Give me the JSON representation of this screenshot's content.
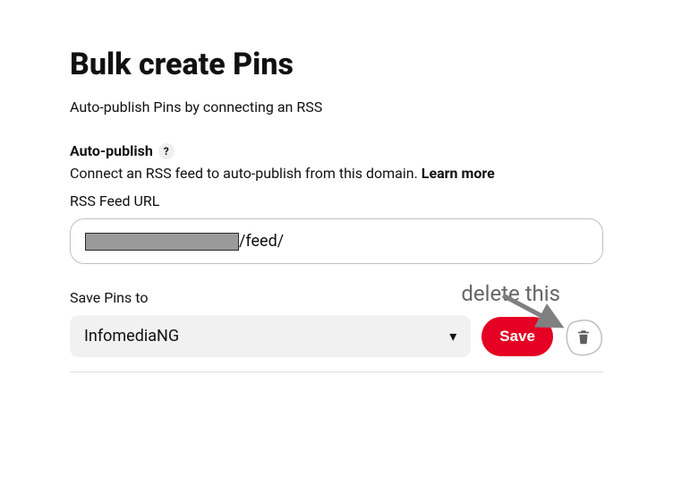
{
  "header": {
    "title": "Bulk create Pins",
    "subtitle": "Auto-publish Pins by connecting an RSS"
  },
  "auto_publish": {
    "label": "Auto-publish",
    "help_symbol": "?",
    "description_pre": "Connect an RSS feed to auto-publish from this domain. ",
    "learn_more": "Learn more",
    "url_field_label": "RSS Feed URL",
    "url_visible_tail": "/feed/"
  },
  "save_section": {
    "label": "Save Pins to",
    "dropdown_value": "InfomediaNG",
    "save_button": "Save"
  },
  "annotation": {
    "text": "delete this"
  },
  "icons": {
    "chevron": "▾"
  }
}
